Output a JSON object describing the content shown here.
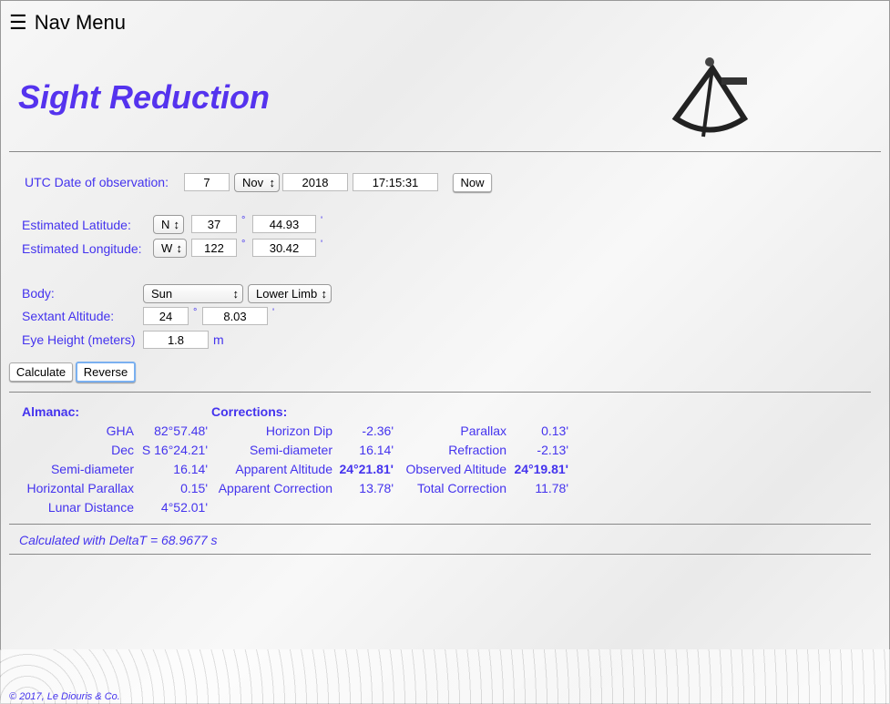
{
  "nav": {
    "label": "Nav Menu"
  },
  "title": "Sight Reduction",
  "date": {
    "label": "UTC Date of observation:",
    "day": "7",
    "month": "Nov",
    "year": "2018",
    "time": "17:15:31",
    "now": "Now"
  },
  "lat": {
    "label": "Estimated Latitude:",
    "hemi": "N",
    "deg": "37",
    "min": "44.93"
  },
  "lon": {
    "label": "Estimated Longitude:",
    "hemi": "W",
    "deg": "122",
    "min": "30.42"
  },
  "body": {
    "label": "Body:",
    "value": "Sun",
    "limb": "Lower Limb"
  },
  "sextant": {
    "label": "Sextant Altitude:",
    "deg": "24",
    "min": "8.03"
  },
  "eye": {
    "label": "Eye Height (meters)",
    "value": "1.8",
    "unit": "m"
  },
  "units": {
    "deg": "°",
    "min": "'"
  },
  "buttons": {
    "calculate": "Calculate",
    "reverse": "Reverse"
  },
  "results": {
    "almanac": "Almanac:",
    "corrections": "Corrections:",
    "rows": [
      [
        "GHA",
        "82°57.48'",
        "Horizon Dip",
        "-2.36'",
        "Parallax",
        "0.13'"
      ],
      [
        "Dec",
        "S 16°24.21'",
        "Semi-diameter",
        "16.14'",
        "Refraction",
        "-2.13'"
      ],
      [
        "Semi-diameter",
        "16.14'",
        "Apparent Altitude",
        "24°21.81'",
        "Observed Altitude",
        "24°19.81'"
      ],
      [
        "Horizontal Parallax",
        "0.15'",
        "Apparent Correction",
        "13.78'",
        "Total Correction",
        "11.78'"
      ],
      [
        "Lunar Distance",
        "4°52.01'",
        "",
        "",
        "",
        ""
      ]
    ]
  },
  "deltat": "Calculated with DeltaT = 68.9677 s",
  "footer": "© 2017, Le Diouris & Co."
}
